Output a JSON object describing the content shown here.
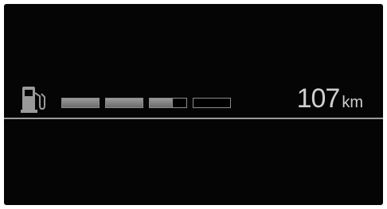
{
  "fuel_gauge": {
    "icon": "fuel-pump-icon",
    "segment_fill": [
      1,
      1,
      0.6,
      0
    ],
    "level_fraction": 0.65,
    "fill_color": "#8a8a8a",
    "border_color": "#8a8a8a",
    "background_color": "#050505"
  },
  "range": {
    "value": "107",
    "unit": "km",
    "text_color": "#cfcfcf"
  }
}
